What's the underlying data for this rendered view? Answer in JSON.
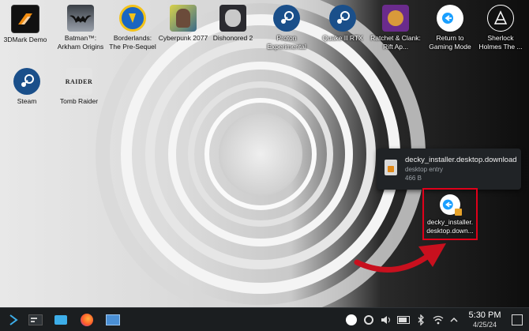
{
  "desktop_icons": [
    {
      "label": "3DMark Demo",
      "icon": "3dmark-icon"
    },
    {
      "label": "Batman™: Arkham Origins",
      "icon": "batman-icon"
    },
    {
      "label": "Borderlands: The Pre-Sequel",
      "icon": "borderlands-icon"
    },
    {
      "label": "Cyberpunk 2077",
      "icon": "cyberpunk-icon"
    },
    {
      "label": "Dishonored 2",
      "icon": "dishonored-icon"
    },
    {
      "label": "Proton Experimental",
      "icon": "steam-icon"
    },
    {
      "label": "Quake II RTX",
      "icon": "steam-icon"
    },
    {
      "label": "Ratchet & Clank: Rift Ap...",
      "icon": "ratchet-icon"
    },
    {
      "label": "Return to Gaming Mode",
      "icon": "return-icon"
    },
    {
      "label": "Sherlock Holmes The ...",
      "icon": "sherlock-icon"
    },
    {
      "label": "Steam",
      "icon": "steam-icon"
    },
    {
      "label": "Tomb Raider",
      "icon": "tomb-raider-icon"
    }
  ],
  "tooltip": {
    "filename": "decky_installer.desktop.download",
    "type": "desktop entry",
    "size": "466 B"
  },
  "selected_file": {
    "label_line1": "decky_installer.",
    "label_line2": "desktop.down...",
    "icon": "return-icon"
  },
  "taskbar": {
    "time": "5:30 PM",
    "date": "4/25/24",
    "left_items": [
      "app-launcher-icon",
      "terminal-icon",
      "file-manager-icon",
      "firefox-icon",
      "window-icon"
    ],
    "tray": [
      "steam-icon",
      "update-icon",
      "volume-icon",
      "battery-icon",
      "bluetooth-icon",
      "wifi-icon",
      "chevron-up-icon"
    ]
  }
}
